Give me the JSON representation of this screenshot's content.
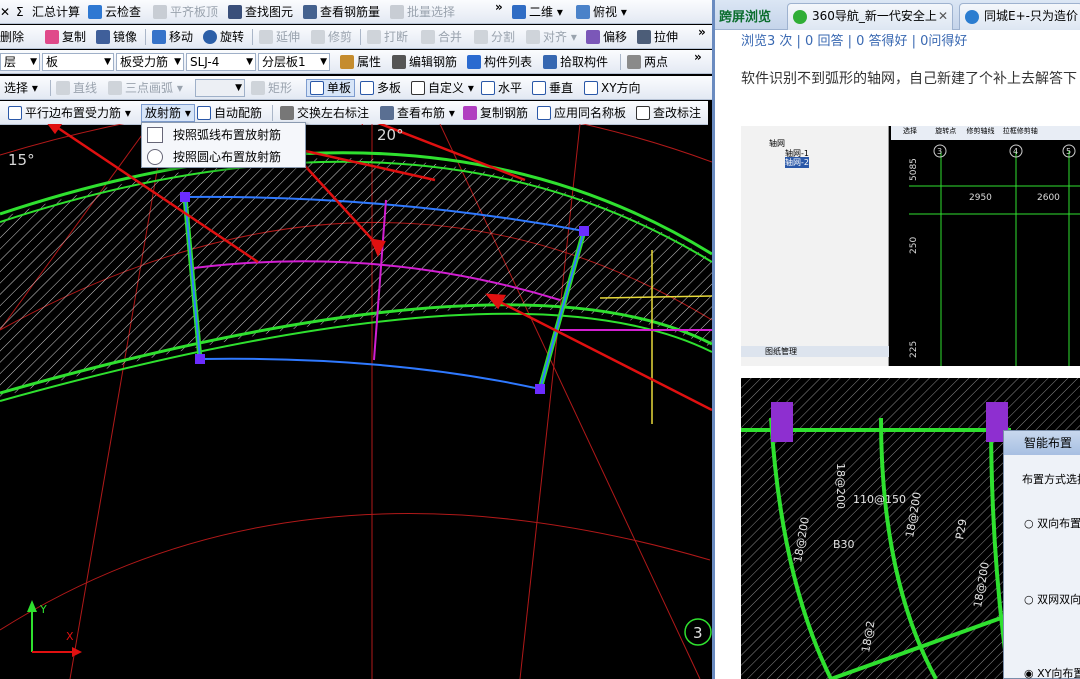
{
  "toolbar1": {
    "items": [
      {
        "label": "汇总计算"
      },
      {
        "label": "云检查"
      },
      {
        "label": "平齐板顶"
      },
      {
        "label": "查找图元"
      },
      {
        "label": "查看钢筋量"
      },
      {
        "label": "批量选择"
      },
      {
        "label": "二维"
      },
      {
        "label": "俯视"
      }
    ]
  },
  "toolbar2": {
    "items": [
      {
        "label": "删除"
      },
      {
        "label": "复制"
      },
      {
        "label": "镜像"
      },
      {
        "label": "移动"
      },
      {
        "label": "旋转"
      },
      {
        "label": "延伸"
      },
      {
        "label": "修剪"
      },
      {
        "label": "打断"
      },
      {
        "label": "合并"
      },
      {
        "label": "分割"
      },
      {
        "label": "对齐"
      },
      {
        "label": "偏移"
      },
      {
        "label": "拉伸"
      }
    ]
  },
  "toolbar3": {
    "layer": "层",
    "category": "板",
    "type": "板受力筋",
    "spec": "SLJ-4",
    "slab_layer": "分层板1",
    "items": [
      {
        "label": "属性"
      },
      {
        "label": "编辑钢筋"
      },
      {
        "label": "构件列表"
      },
      {
        "label": "拾取构件"
      },
      {
        "label": "两点"
      }
    ]
  },
  "toolbar4": {
    "items": [
      {
        "label": "选择"
      },
      {
        "label": "直线"
      },
      {
        "label": "三点画弧"
      },
      {
        "label": "矩形"
      },
      {
        "label": "单板"
      },
      {
        "label": "多板"
      },
      {
        "label": "自定义"
      },
      {
        "label": "水平"
      },
      {
        "label": "垂直"
      },
      {
        "label": "XY方向"
      }
    ]
  },
  "toolbar5": {
    "items": [
      {
        "label": "平行边布置受力筋"
      },
      {
        "label": "放射筋"
      },
      {
        "label": "自动配筋"
      },
      {
        "label": "交换左右标注"
      },
      {
        "label": "查看布筋"
      },
      {
        "label": "复制钢筋"
      },
      {
        "label": "应用同名称板"
      },
      {
        "label": "查改标注"
      }
    ]
  },
  "dropdown": {
    "items": [
      {
        "label": "按照弧线布置放射筋"
      },
      {
        "label": "按照圆心布置放射筋"
      }
    ]
  },
  "canvas": {
    "angle_15": "15°",
    "angle_20": "20°",
    "axis_label": "3",
    "axis_y": "Y",
    "axis_x": "X"
  },
  "browser": {
    "mode": "跨屏浏览",
    "tabs": [
      {
        "label": "360导航_新一代安全上"
      },
      {
        "label": "同城E+-只为造价"
      }
    ],
    "stats": "浏览3 次 | 0 回答 | 0 答得好 | 0问得好",
    "question": "软件识别不到弧形的轴网，自己新建了个补上去解答下"
  },
  "shot1": {
    "tree": [
      "轴网",
      "轴网-1",
      "轴网-2"
    ],
    "panel": "图纸管理",
    "tools": [
      "选择",
      "旋转点",
      "修剪轴线",
      "拉框修剪轴"
    ],
    "dims": [
      "5085",
      "2950",
      "2600",
      "250",
      "225"
    ],
    "axes": [
      "3",
      "4",
      "5"
    ]
  },
  "shot2": {
    "rebar_labels": [
      "B30",
      "110@150",
      "18@200",
      "18@200",
      "18@200",
      "18@2",
      "P29",
      "18@200"
    ],
    "dialog_title": "智能布置",
    "dialog_label": "布置方式选择",
    "options": [
      {
        "label": "双向布置"
      },
      {
        "label": "双网双向布"
      },
      {
        "label": "XY向布置"
      }
    ]
  },
  "colors": {
    "slab_edge": "#2fe02f",
    "rebar": "#d21fd2",
    "grid_line": "#d01e1e",
    "annotation": "#e01010",
    "link": "#3a69b2"
  }
}
